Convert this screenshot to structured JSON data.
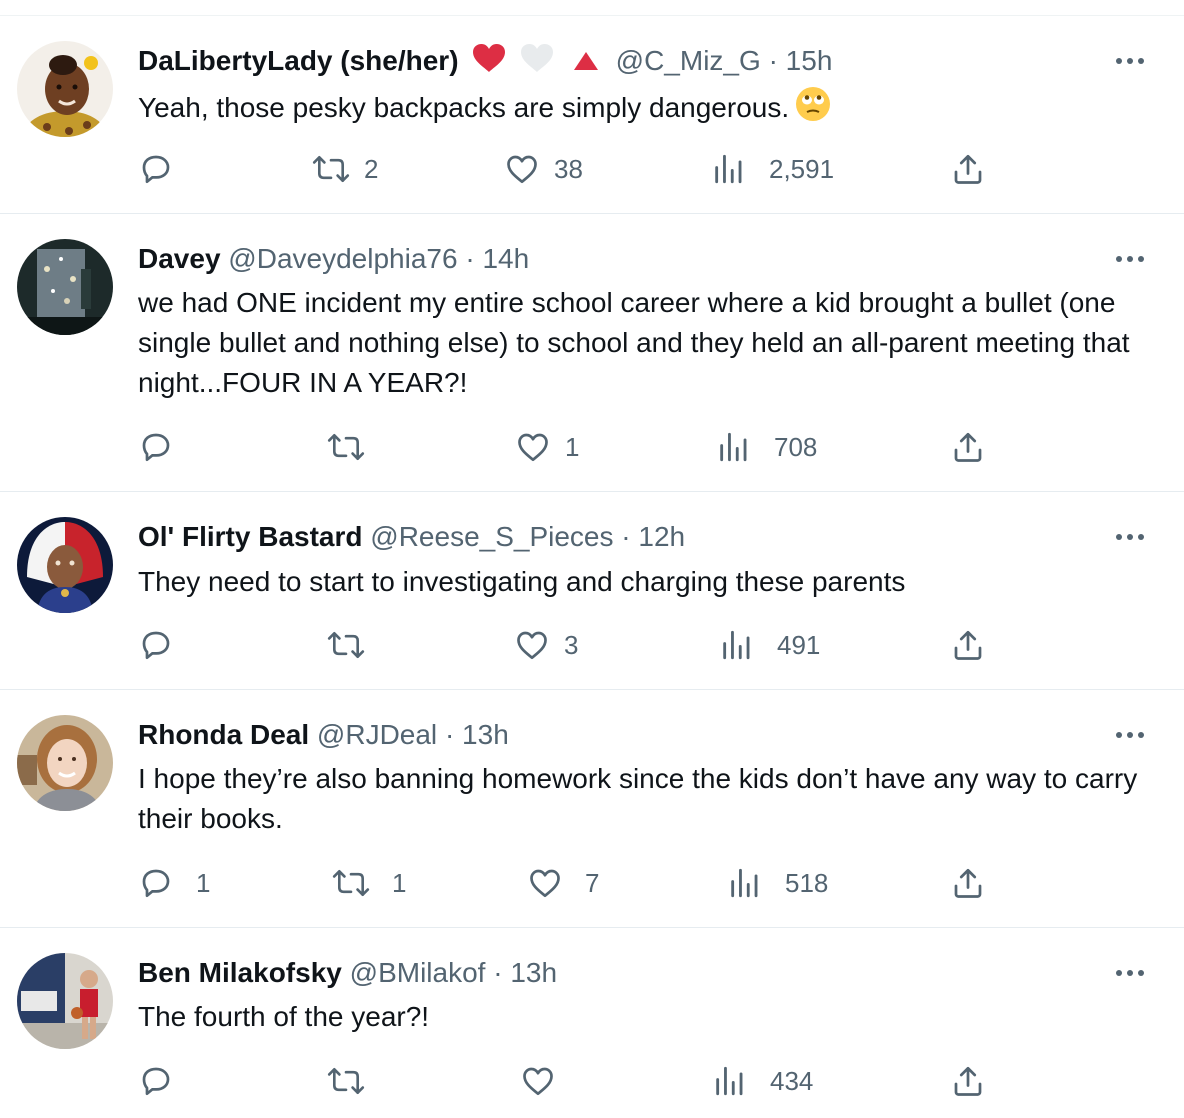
{
  "tweets": [
    {
      "display_name": "DaLibertyLady (she/her)",
      "badges": [
        "red-heart",
        "white-heart",
        "red-triangle"
      ],
      "handle": "@C_Miz_G",
      "time": "15h",
      "text": "Yeah, those pesky backpacks are simply dangerous.",
      "emoji": "face-with-rolling-eyes",
      "replies": "",
      "retweets": "2",
      "likes": "38",
      "views": "2,591"
    },
    {
      "display_name": "Davey",
      "handle": "@Daveydelphia76",
      "time": "14h",
      "text": "we had ONE incident my entire school career where a kid brought a bullet (one single bullet and nothing else) to school and they held an all-parent meeting that night...FOUR IN A YEAR?!",
      "replies": "",
      "retweets": "",
      "likes": "1",
      "views": "708"
    },
    {
      "display_name": "Ol' Flirty Bastard",
      "handle": "@Reese_S_Pieces",
      "time": "12h",
      "text": "They need to start to investigating and charging these parents",
      "replies": "",
      "retweets": "",
      "likes": "3",
      "views": "491"
    },
    {
      "display_name": "Rhonda Deal",
      "handle": "@RJDeal",
      "time": "13h",
      "text": "I hope they’re also banning homework since the kids don’t have any way to carry their books.",
      "replies": "1",
      "retweets": "1",
      "likes": "7",
      "views": "518"
    },
    {
      "display_name": "Ben Milakofsky",
      "handle": "@BMilakof",
      "time": "13h",
      "text": "The fourth of the year?!",
      "replies": "",
      "retweets": "",
      "likes": "",
      "views": "434"
    }
  ],
  "separator": "·",
  "icons": {
    "reply": "reply-icon",
    "retweet": "retweet-icon",
    "like": "heart-icon",
    "views": "views-chart-icon",
    "share": "share-icon",
    "more": "more-icon"
  },
  "colors": {
    "text": "#0f1419",
    "secondary": "#536471",
    "divider": "#e6ecf0",
    "heart_red": "#e0245e"
  }
}
